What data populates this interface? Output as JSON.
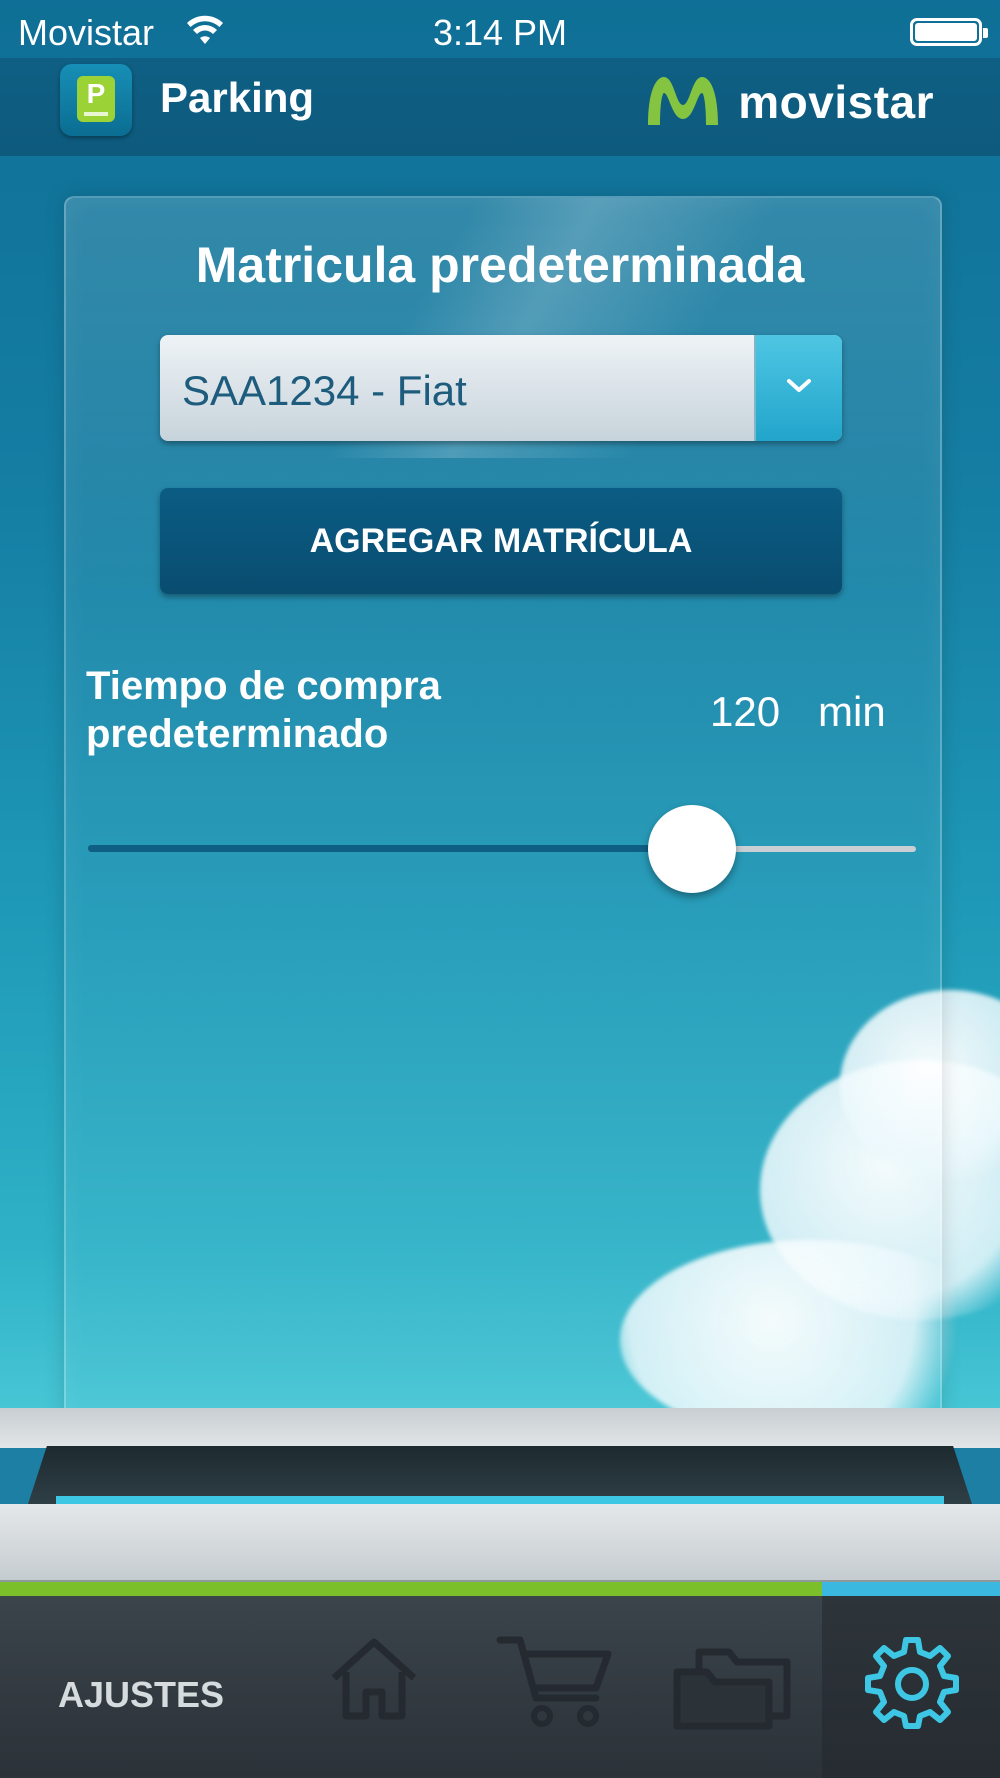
{
  "status_bar": {
    "carrier": "Movistar",
    "time": "3:14 PM"
  },
  "header": {
    "app_title": "Parking",
    "brand": "movistar"
  },
  "settings": {
    "title": "Matricula predeterminada",
    "plate_dropdown_value": "SAA1234 - Fiat",
    "add_plate_label": "AGREGAR MATRÍCULA",
    "time_label": "Tiempo de compra predeterminado",
    "time_value": "120",
    "time_unit": "min",
    "slider_fraction": 0.73
  },
  "tabbar": {
    "active_label": "AJUSTES",
    "tabs": [
      {
        "icon": "home-icon"
      },
      {
        "icon": "cart-icon"
      },
      {
        "icon": "folders-icon"
      },
      {
        "icon": "gear-icon",
        "active": true
      }
    ]
  },
  "colors": {
    "accent_green": "#7bbf2a",
    "accent_blue": "#3ab8e0",
    "header_blue": "#0f5f84"
  }
}
